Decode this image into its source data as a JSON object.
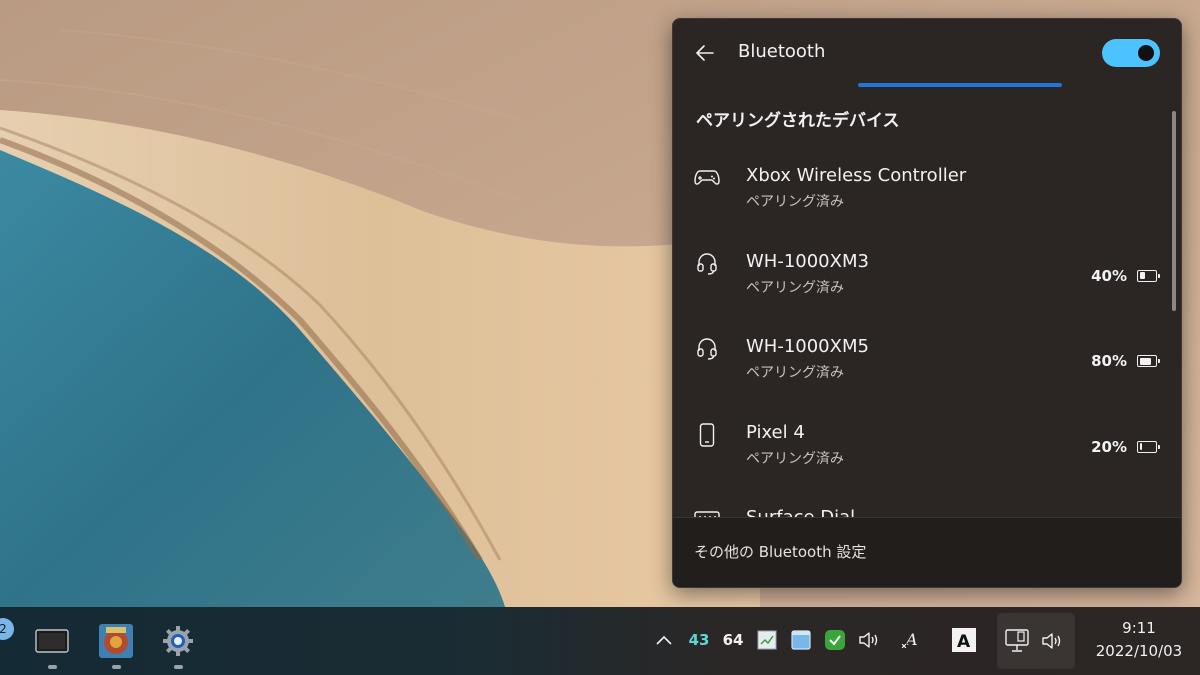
{
  "bluetooth_panel": {
    "title": "Bluetooth",
    "toggle_on": true,
    "section_heading": "ペアリングされたデバイス",
    "devices": [
      {
        "name": "Xbox Wireless Controller",
        "status": "ペアリング済み",
        "icon": "gamepad-icon",
        "battery": ""
      },
      {
        "name": "WH-1000XM3",
        "status": "ペアリング済み",
        "icon": "headset-icon",
        "battery": "40%",
        "battery_level": 0.4
      },
      {
        "name": "WH-1000XM5",
        "status": "ペアリング済み",
        "icon": "headset-icon",
        "battery": "80%",
        "battery_level": 0.8
      },
      {
        "name": "Pixel 4",
        "status": "ペアリング済み",
        "icon": "phone-icon",
        "battery": "20%",
        "battery_level": 0.2
      },
      {
        "name": "Surface Dial",
        "status": "",
        "icon": "keyboard-icon",
        "battery": ""
      }
    ],
    "footer_link": "その他の Bluetooth 設定"
  },
  "taskbar": {
    "badge_count": "2",
    "apps": [
      {
        "name": "terminal-app-icon"
      },
      {
        "name": "game-app-icon"
      },
      {
        "name": "settings-gear-icon"
      }
    ],
    "tray": {
      "overflow_icon": "chevron-up-icon",
      "value_1": "43",
      "value_1_color": "#5fd6d6",
      "value_2": "64",
      "ime_label": "A"
    },
    "clock": {
      "time": "9:11",
      "date": "2022/10/03"
    }
  },
  "colors": {
    "panel_bg": "#2b2624",
    "accent_toggle": "#4cc2ff",
    "progress": "#1e78d8"
  }
}
